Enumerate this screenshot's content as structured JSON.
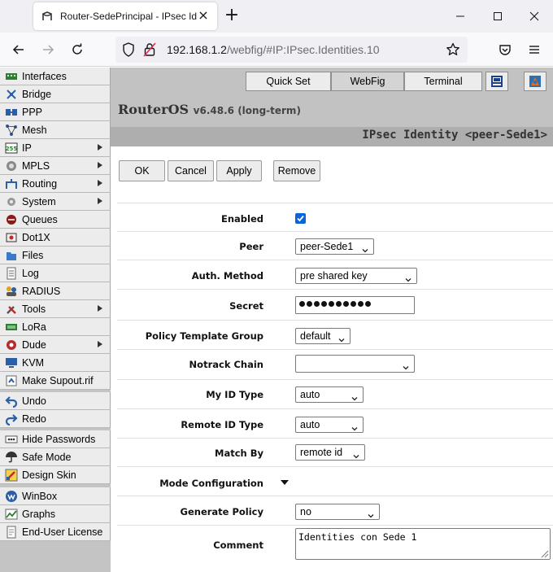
{
  "browser": {
    "tab_title": "Router-SedePrincipal - IPsec Ide",
    "url_host": "192.168.1.2",
    "url_path": "/webfig/#IP:IPsec.Identities.10"
  },
  "sidebar": {
    "items": [
      {
        "label": "Interfaces",
        "icon": "interfaces-icon",
        "submenu": false
      },
      {
        "label": "Bridge",
        "icon": "bridge-icon",
        "submenu": false
      },
      {
        "label": "PPP",
        "icon": "ppp-icon",
        "submenu": false
      },
      {
        "label": "Mesh",
        "icon": "mesh-icon",
        "submenu": false
      },
      {
        "label": "IP",
        "icon": "ip-icon",
        "submenu": true
      },
      {
        "label": "MPLS",
        "icon": "mpls-icon",
        "submenu": true
      },
      {
        "label": "Routing",
        "icon": "routing-icon",
        "submenu": true
      },
      {
        "label": "System",
        "icon": "system-icon",
        "submenu": true
      },
      {
        "label": "Queues",
        "icon": "queues-icon",
        "submenu": false
      },
      {
        "label": "Dot1X",
        "icon": "dot1x-icon",
        "submenu": false
      },
      {
        "label": "Files",
        "icon": "files-icon",
        "submenu": false
      },
      {
        "label": "Log",
        "icon": "log-icon",
        "submenu": false
      },
      {
        "label": "RADIUS",
        "icon": "radius-icon",
        "submenu": false
      },
      {
        "label": "Tools",
        "icon": "tools-icon",
        "submenu": true
      },
      {
        "label": "LoRa",
        "icon": "lora-icon",
        "submenu": false
      },
      {
        "label": "Dude",
        "icon": "dude-icon",
        "submenu": true
      },
      {
        "label": "KVM",
        "icon": "kvm-icon",
        "submenu": false
      },
      {
        "label": "Make Supout.rif",
        "icon": "supout-icon",
        "submenu": false
      },
      {
        "label": "Undo",
        "icon": "undo-icon",
        "submenu": false
      },
      {
        "label": "Redo",
        "icon": "redo-icon",
        "submenu": false
      },
      {
        "label": "Hide Passwords",
        "icon": "hide-passwords-icon",
        "submenu": false
      },
      {
        "label": "Safe Mode",
        "icon": "safe-mode-icon",
        "submenu": false
      },
      {
        "label": "Design Skin",
        "icon": "design-skin-icon",
        "submenu": false
      },
      {
        "label": "WinBox",
        "icon": "winbox-icon",
        "submenu": false
      },
      {
        "label": "Graphs",
        "icon": "graphs-icon",
        "submenu": false
      },
      {
        "label": "End-User License",
        "icon": "license-icon",
        "submenu": false
      }
    ]
  },
  "topbar": {
    "quickset": "Quick Set",
    "webfig": "WebFig",
    "terminal": "Terminal",
    "product": "RouterOS",
    "version": "v6.48.6 (long-term)",
    "page_title": "IPsec Identity <peer-Sede1>"
  },
  "actions": {
    "ok": "OK",
    "cancel": "Cancel",
    "apply": "Apply",
    "remove": "Remove"
  },
  "form": {
    "enabled_label": "Enabled",
    "enabled_checked": true,
    "peer_label": "Peer",
    "peer_value": "peer-Sede1",
    "auth_label": "Auth. Method",
    "auth_value": "pre shared key",
    "secret_label": "Secret",
    "secret_length": 10,
    "ptg_label": "Policy Template Group",
    "ptg_value": "default",
    "notrack_label": "Notrack Chain",
    "notrack_value": "",
    "myid_label": "My ID Type",
    "myid_value": "auto",
    "remoteid_label": "Remote ID Type",
    "remoteid_value": "auto",
    "matchby_label": "Match By",
    "matchby_value": "remote id",
    "modeconf_label": "Mode Configuration",
    "genpolicy_label": "Generate Policy",
    "genpolicy_value": "no",
    "comment_label": "Comment",
    "comment_value": "Identities con Sede 1"
  },
  "colors": {
    "accent": "#0b65d8",
    "sidebar_bg": "#c4c4c4",
    "topbar_bg": "#c2c2c2",
    "subbar_bg": "#aeaeae"
  }
}
